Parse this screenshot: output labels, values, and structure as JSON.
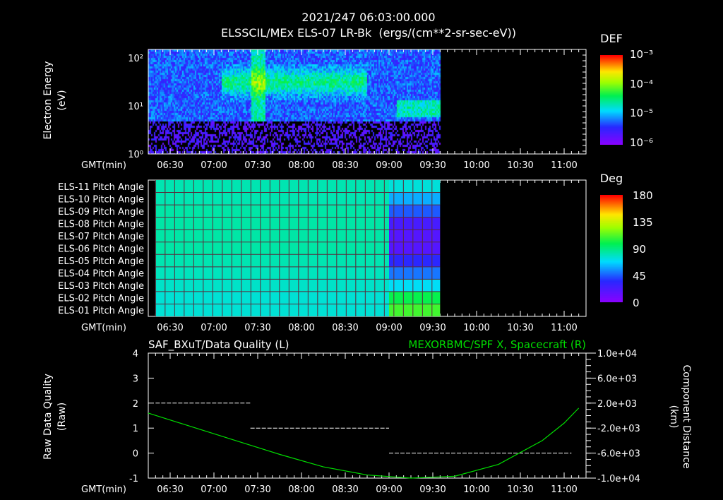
{
  "header": {
    "datetime": "2021/247 06:03:00.000",
    "title": "ELSSCIL/MEx ELS-07 LR-Bk  (ergs/(cm**2-sr-sec-eV))"
  },
  "time_axis": {
    "label": "GMT(min)",
    "start": "06:15",
    "end": "11:15",
    "ticks": [
      "06:30",
      "07:00",
      "07:30",
      "08:00",
      "08:30",
      "09:00",
      "09:30",
      "10:00",
      "10:30",
      "11:00"
    ]
  },
  "chart_data": [
    {
      "type": "heatmap",
      "panel": "spectrogram",
      "ylabel": "Electron Energy",
      "yunit": "(eV)",
      "yscale": "log",
      "ylim": [
        1,
        150
      ],
      "yticks": [
        "10⁰",
        "10¹",
        "10²"
      ],
      "colorbar": {
        "title": "DEF",
        "scale": "log",
        "range": [
          1e-06,
          0.001
        ],
        "ticks": [
          "10⁻³",
          "10⁻⁴",
          "10⁻⁵",
          "10⁻⁶"
        ]
      },
      "data_end": "09:35"
    },
    {
      "type": "heatmap",
      "panel": "pitch-angle",
      "rows": [
        "ELS-11 Pitch Angle",
        "ELS-10 Pitch Angle",
        "ELS-09 Pitch Angle",
        "ELS-08 Pitch Angle",
        "ELS-07 Pitch Angle",
        "ELS-06 Pitch Angle",
        "ELS-05 Pitch Angle",
        "ELS-04 Pitch Angle",
        "ELS-03 Pitch Angle",
        "ELS-02 Pitch Angle",
        "ELS-01 Pitch Angle"
      ],
      "segments": [
        {
          "start": "06:20",
          "end": "09:00",
          "values": [
            82,
            82,
            84,
            84,
            84,
            84,
            82,
            80,
            78,
            76,
            76
          ]
        },
        {
          "start": "09:00",
          "end": "09:35",
          "values": [
            75,
            60,
            45,
            25,
            20,
            20,
            35,
            50,
            70,
            100,
            110
          ]
        }
      ],
      "colorbar": {
        "title": "Deg",
        "range": [
          0,
          180
        ],
        "ticks": [
          "180",
          "135",
          "90",
          "45",
          "0"
        ]
      }
    },
    {
      "type": "line",
      "panel": "data-quality",
      "left_title": "SAF_BXuT/Data Quality (L)",
      "right_title": "MEXORBMC/SPF X, Spacecraft (R)",
      "ylabel": "Raw Data Quality",
      "yunit": "(Raw)",
      "ylim": [
        -1,
        4
      ],
      "yticks": [
        "4",
        "3",
        "2",
        "1",
        "0",
        "-1"
      ],
      "y2label": "Component Distance",
      "y2unit": "(km)",
      "y2lim": [
        -10000,
        10000
      ],
      "y2ticks": [
        "1.0e+04",
        "6.0e+03",
        "2.0e+03",
        "-2.0e+03",
        "-6.0e+03",
        "-1.0e+04"
      ],
      "series": [
        {
          "axis": "left",
          "color": "#ffffff",
          "style": "dashed",
          "steps": [
            {
              "start": "06:20",
              "end": "07:25",
              "value": 2
            },
            {
              "start": "07:25",
              "end": "09:00",
              "value": 1
            },
            {
              "start": "09:00",
              "end": "11:05",
              "value": 0
            }
          ]
        },
        {
          "axis": "right",
          "color": "#00dd00",
          "x": [
            "06:15",
            "06:45",
            "07:15",
            "07:45",
            "08:15",
            "08:45",
            "09:15",
            "09:45",
            "10:15",
            "10:45",
            "11:00",
            "11:10"
          ],
          "y": [
            400,
            -1800,
            -4000,
            -6200,
            -8200,
            -9500,
            -10000,
            -9700,
            -7800,
            -4000,
            -1200,
            1200
          ]
        }
      ]
    }
  ]
}
